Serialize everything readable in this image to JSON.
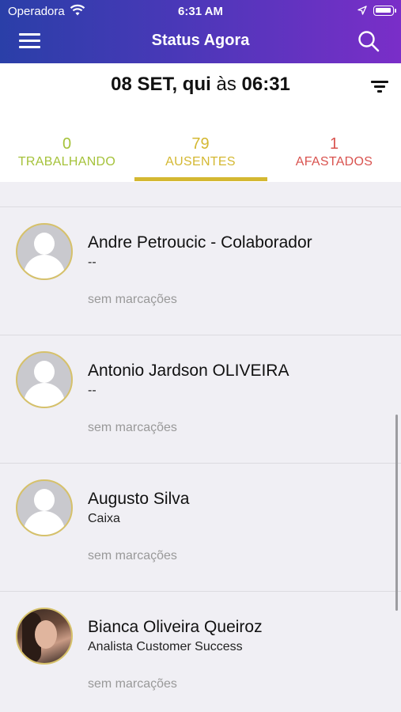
{
  "status_bar": {
    "carrier": "Operadora",
    "time": "6:31 AM"
  },
  "nav": {
    "title": "Status Agora",
    "menu_icon": "hamburger-menu-icon",
    "search_icon": "search-icon"
  },
  "date": {
    "day": "08 SET, qui",
    "connector": "às",
    "time": "06:31",
    "filter_icon": "filter-icon"
  },
  "tabs": [
    {
      "count": "0",
      "label": "TRABALHANDO",
      "color": "#a5c23a"
    },
    {
      "count": "79",
      "label": "AUSENTES",
      "color": "#d4b832",
      "selected": true
    },
    {
      "count": "1",
      "label": "AFASTADOS",
      "color": "#d9534f"
    }
  ],
  "employees": [
    {
      "name": "Andre Petroucic - Colaborador",
      "role": "--",
      "marks": "sem marcações",
      "avatar": "placeholder"
    },
    {
      "name": "Antonio Jardson OLIVEIRA",
      "role": "--",
      "marks": "sem marcações",
      "avatar": "placeholder"
    },
    {
      "name": "Augusto Silva",
      "role": "Caixa",
      "marks": "sem marcações",
      "avatar": "placeholder"
    },
    {
      "name": "Bianca Oliveira Queiroz",
      "role": "Analista Customer Success",
      "marks": "sem marcações",
      "avatar": "photo"
    }
  ]
}
